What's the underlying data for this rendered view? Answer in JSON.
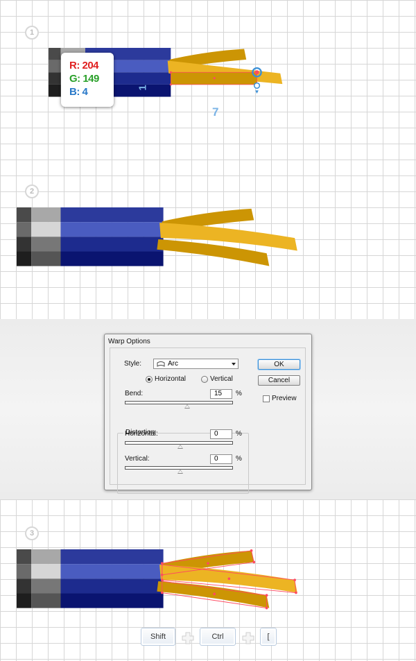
{
  "steps": [
    "1",
    "2",
    "3"
  ],
  "color_readout": {
    "r_label": "R: 204",
    "g_label": "G: 149",
    "b_label": "B: 4",
    "r_color": "#e02020",
    "g_color": "#2aa02a",
    "b_color": "#2878c8"
  },
  "dimensions": {
    "height": "1",
    "width": "7"
  },
  "palette": {
    "blue_dark": "#0a1470",
    "blue_mid": "#1d2b8e",
    "blue_light": "#4a5cc0",
    "blue_top": "#2c3a9c",
    "yellow": "#ecb423",
    "yellow_dark": "#cc9504",
    "guide": "#ff4a60"
  },
  "dialog": {
    "title": "Warp Options",
    "style_label": "Style:",
    "style_value": "Arc",
    "orientation": {
      "horizontal": "Horizontal",
      "vertical": "Vertical",
      "selected": "Horizontal"
    },
    "bend_label": "Bend:",
    "bend_value": "15",
    "bend_unit": "%",
    "distortion_title": "Distortion",
    "horizontal_label": "Horizontal:",
    "horizontal_value": "0",
    "horizontal_unit": "%",
    "vertical_label": "Vertical:",
    "vertical_value": "0",
    "vertical_unit": "%",
    "ok_label": "OK",
    "cancel_label": "Cancel",
    "preview_label": "Preview",
    "preview_checked": false
  },
  "shortcut": {
    "keys": [
      "Shift",
      "Ctrl",
      "["
    ]
  }
}
